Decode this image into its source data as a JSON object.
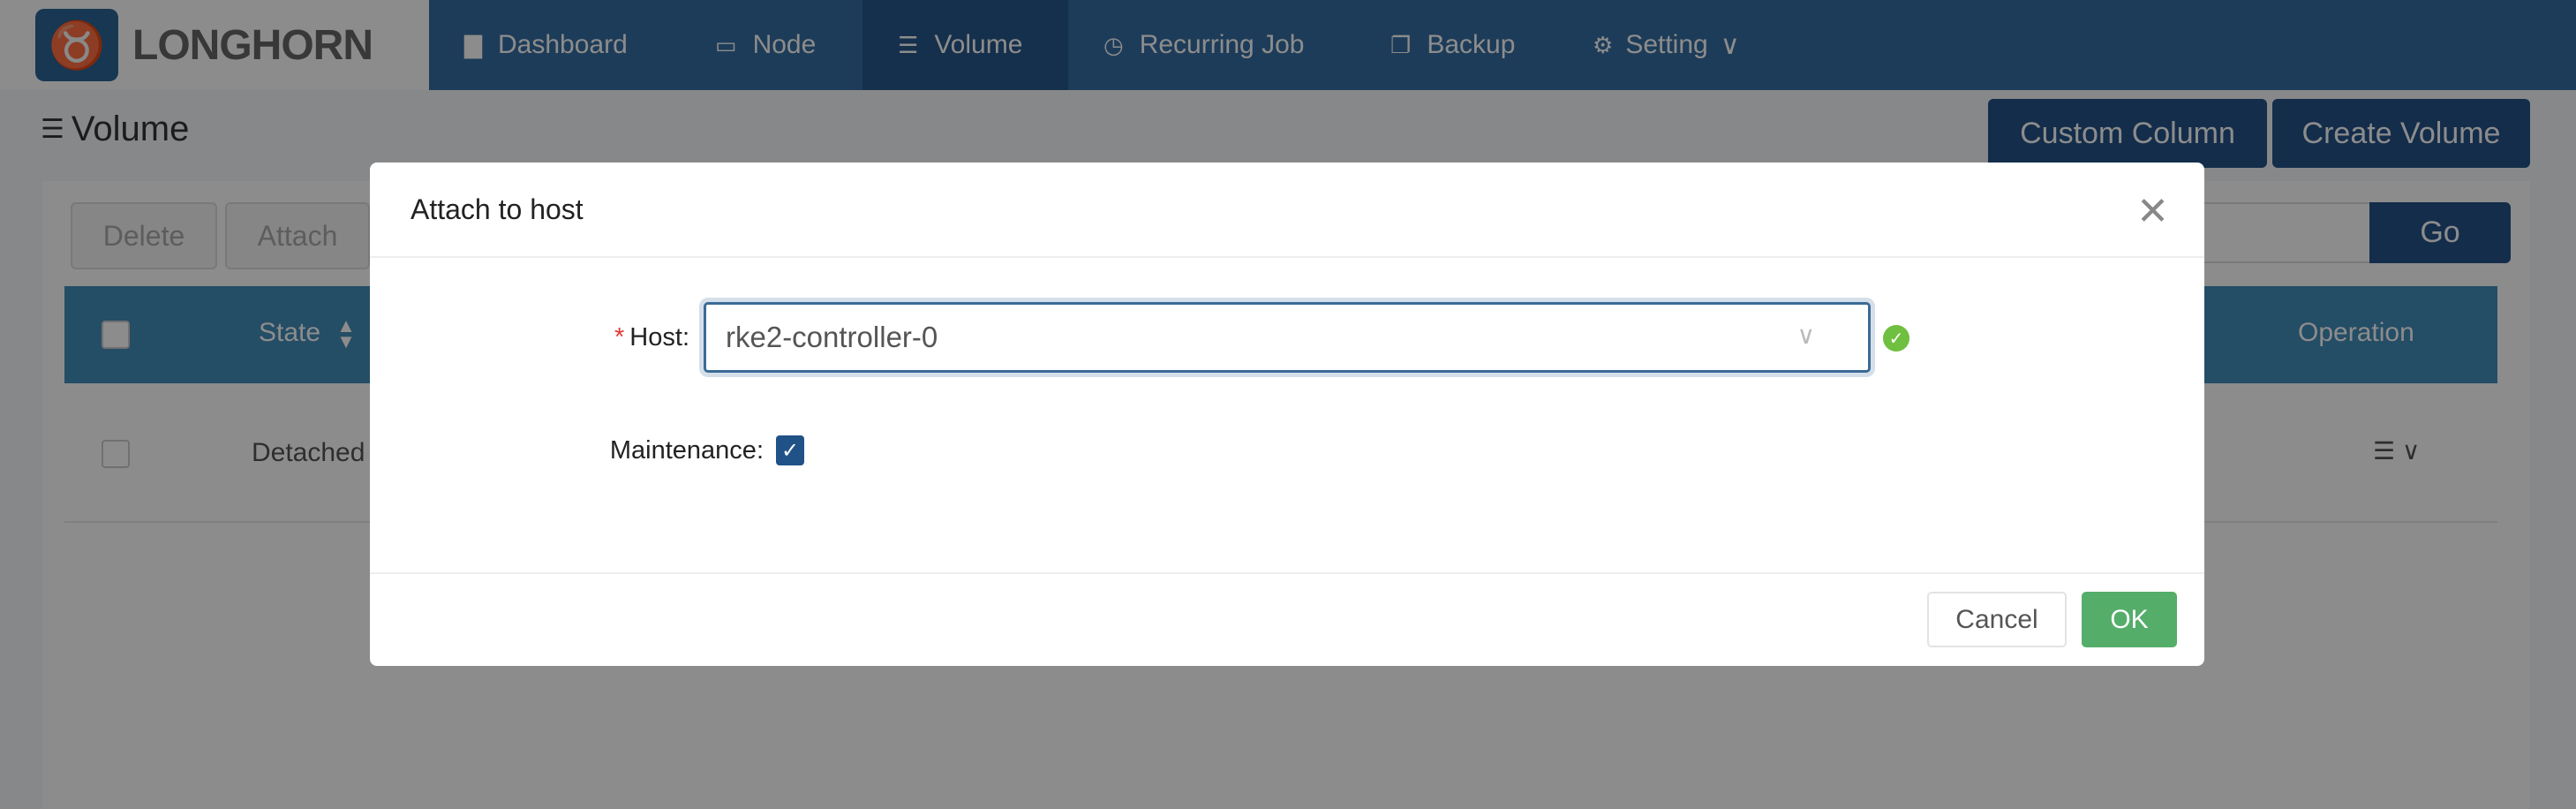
{
  "app": {
    "logo_text": "LONGHORN"
  },
  "nav": {
    "items": [
      {
        "label": "Dashboard",
        "icon": "bar-chart-icon"
      },
      {
        "label": "Node",
        "icon": "laptop-icon"
      },
      {
        "label": "Volume",
        "icon": "database-icon",
        "active": true
      },
      {
        "label": "Recurring Job",
        "icon": "clock-icon"
      },
      {
        "label": "Backup",
        "icon": "copy-icon"
      },
      {
        "label": "Setting",
        "icon": "gear-icon"
      }
    ]
  },
  "page": {
    "title": "Volume",
    "custom_column": "Custom Column",
    "create_volume": "Create Volume"
  },
  "toolbar": {
    "delete": "Delete",
    "attach": "Attach",
    "go": "Go"
  },
  "table": {
    "headers": {
      "state": "State",
      "operation": "Operation"
    },
    "rows": [
      {
        "state": "Detached"
      }
    ]
  },
  "modal": {
    "title": "Attach to host",
    "host_label": "Host",
    "host_value": "rke2-controller-0",
    "maintenance_label": "Maintenance",
    "maintenance_checked": true,
    "cancel": "Cancel",
    "ok": "OK"
  },
  "colors": {
    "nav": "#356da2",
    "primary": "#245289",
    "ok": "#55ad6a",
    "valid": "#6fbf40",
    "required": "#e53935"
  }
}
